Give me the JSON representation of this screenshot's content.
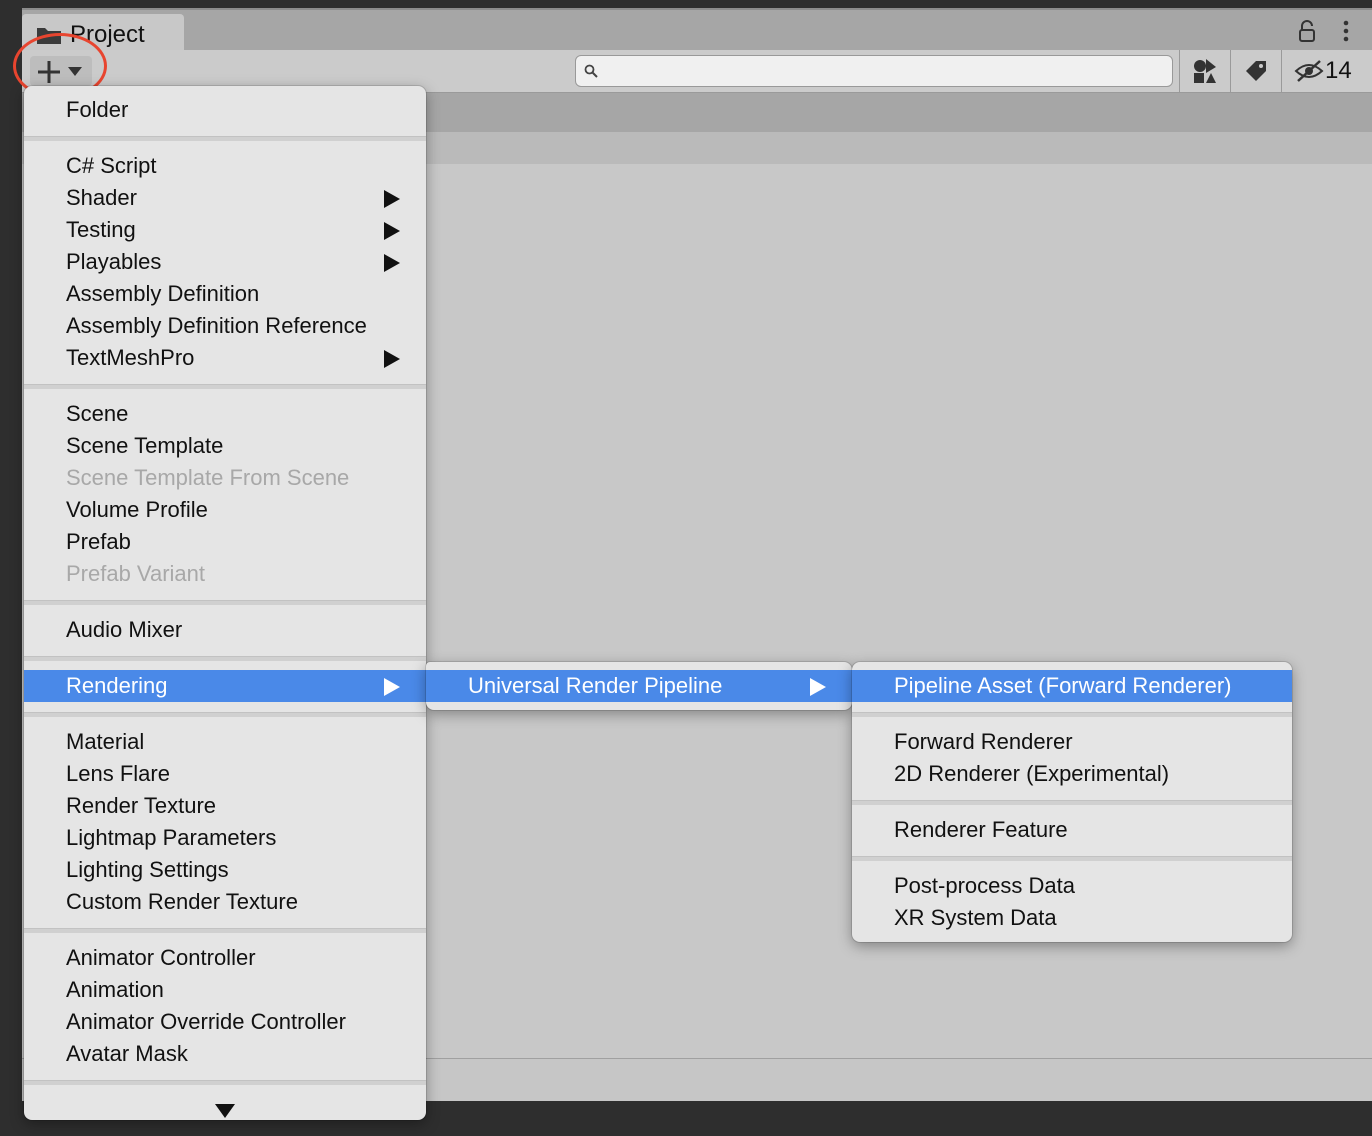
{
  "window": {
    "tab_title": "Project",
    "hidden_count": "14",
    "search": {
      "value": "",
      "placeholder": ""
    }
  },
  "icons": {
    "folder": "folder-icon",
    "lock": "lock-icon",
    "kebab": "kebab-menu-icon",
    "create": "plus-icon",
    "dropdown": "chevron-down-icon",
    "search": "search-icon",
    "type_filter": "type-filter-icon",
    "label_filter": "label-icon",
    "hidden": "eye-slash-icon",
    "submenu": "triangle-right-icon",
    "scroll": "triangle-down-icon"
  },
  "colors": {
    "highlight": "#4a89e8",
    "annotation": "#e8452f",
    "disabled_text": "#a8a8a8"
  },
  "create_menu": {
    "items": [
      {
        "label": "Folder"
      },
      {
        "label": "C# Script"
      },
      {
        "label": "Shader",
        "submenu": true
      },
      {
        "label": "Testing",
        "submenu": true
      },
      {
        "label": "Playables",
        "submenu": true
      },
      {
        "label": "Assembly Definition"
      },
      {
        "label": "Assembly Definition Reference"
      },
      {
        "label": "TextMeshPro",
        "submenu": true
      },
      {
        "label": "Scene"
      },
      {
        "label": "Scene Template"
      },
      {
        "label": "Scene Template From Scene",
        "disabled": true
      },
      {
        "label": "Volume Profile"
      },
      {
        "label": "Prefab"
      },
      {
        "label": "Prefab Variant",
        "disabled": true
      },
      {
        "label": "Audio Mixer"
      },
      {
        "label": "Rendering",
        "submenu": true,
        "active": true
      },
      {
        "label": "Material"
      },
      {
        "label": "Lens Flare"
      },
      {
        "label": "Render Texture"
      },
      {
        "label": "Lightmap Parameters"
      },
      {
        "label": "Lighting Settings"
      },
      {
        "label": "Custom Render Texture"
      },
      {
        "label": "Animator Controller"
      },
      {
        "label": "Animation"
      },
      {
        "label": "Animator Override Controller"
      },
      {
        "label": "Avatar Mask"
      }
    ]
  },
  "rendering_menu": {
    "items": [
      {
        "label": "Universal Render Pipeline",
        "submenu": true,
        "active": true
      }
    ]
  },
  "urp_menu": {
    "items": [
      {
        "label": "Pipeline Asset (Forward Renderer)",
        "active": true
      },
      {
        "label": "Forward Renderer"
      },
      {
        "label": "2D Renderer (Experimental)"
      },
      {
        "label": "Renderer Feature"
      },
      {
        "label": "Post-process Data"
      },
      {
        "label": "XR System Data"
      }
    ]
  }
}
